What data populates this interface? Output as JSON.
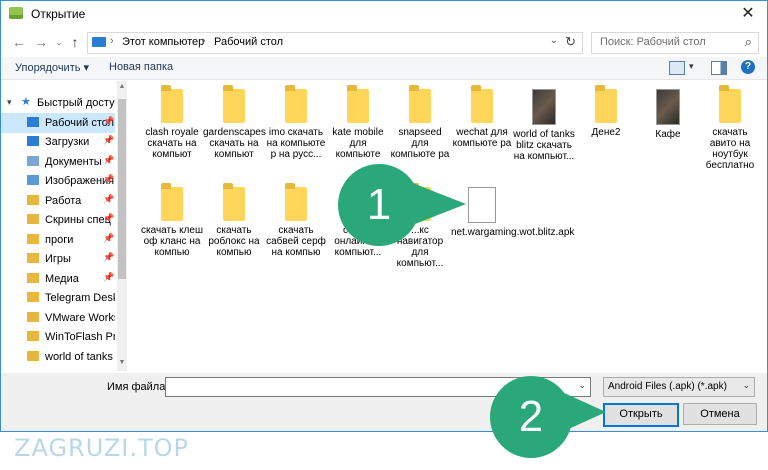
{
  "window": {
    "title": "Открытие"
  },
  "nav": {
    "address": [
      "Этот компьютер",
      "Рабочий стол"
    ],
    "search_placeholder": "Поиск: Рабочий стол"
  },
  "toolbar": {
    "organize": "Упорядочить",
    "new_folder": "Новая папка"
  },
  "sidebar": {
    "items": [
      {
        "label": "Быстрый доступ",
        "icon": "star-icon",
        "pinned": false
      },
      {
        "label": "Рабочий стол",
        "icon": "desktop-icon",
        "pinned": true
      },
      {
        "label": "Загрузки",
        "icon": "download-icon",
        "pinned": true
      },
      {
        "label": "Документы",
        "icon": "documents-icon",
        "pinned": true
      },
      {
        "label": "Изображения",
        "icon": "images-icon",
        "pinned": true
      },
      {
        "label": "Работа",
        "icon": "folder-icon",
        "pinned": true
      },
      {
        "label": "Скрины спец",
        "icon": "folder-icon",
        "pinned": true
      },
      {
        "label": "проги",
        "icon": "folder-icon",
        "pinned": true
      },
      {
        "label": "Игры",
        "icon": "folder-icon",
        "pinned": true
      },
      {
        "label": "Медиа",
        "icon": "folder-icon",
        "pinned": true
      },
      {
        "label": "Telegram Desktop",
        "icon": "folder-icon",
        "pinned": false
      },
      {
        "label": "VMware Workstation",
        "icon": "folder-icon",
        "pinned": false
      },
      {
        "label": "WinToFlash Prof",
        "icon": "folder-icon",
        "pinned": false
      },
      {
        "label": "world of tanks b",
        "icon": "folder-icon",
        "pinned": false
      }
    ]
  },
  "files": [
    {
      "label": "clash royale скачать на компьют",
      "kind": "folder"
    },
    {
      "label": "gardenscapes скачать на компьют",
      "kind": "folder"
    },
    {
      "label": "imo скачать на компьюте р на русс...",
      "kind": "folder"
    },
    {
      "label": "kate mobile для компьюте",
      "kind": "folder"
    },
    {
      "label": "snapseed для компьюте ра",
      "kind": "folder"
    },
    {
      "label": "wechat для компьюте ра",
      "kind": "folder"
    },
    {
      "label": "world of tanks blitz скачать на компьют...",
      "kind": "thumb"
    },
    {
      "label": "Дене2",
      "kind": "folder"
    },
    {
      "label": "Кафе",
      "kind": "thumb"
    },
    {
      "label": "скачать авито на ноутбук бесплатно",
      "kind": "folder"
    },
    {
      "label": "скачать клеш оф кланс на компью",
      "kind": "folder"
    },
    {
      "label": "скачать роблокс на компью",
      "kind": "folder"
    },
    {
      "label": "скачать сабвей серф на компью",
      "kind": "folder"
    },
    {
      "label": "сбер... онлайн на компьют...",
      "kind": "folder"
    },
    {
      "label": "...кс навигатор для компьют...",
      "kind": "folder"
    },
    {
      "label": "net.wargaming.wot.blitz.apk",
      "kind": "file"
    }
  ],
  "footer": {
    "filename_label": "Имя файла:",
    "filename_value": "",
    "filetype": "Android Files (.apk) (*.apk)",
    "open": "Открыть",
    "cancel": "Отмена"
  },
  "annotations": {
    "bubble1": "1",
    "bubble2": "2"
  },
  "watermark": "ZAGRUZI.TOP",
  "colors": {
    "accent": "#0078d7",
    "bubble": "#2aa87a",
    "selection": "#cce8ff"
  }
}
